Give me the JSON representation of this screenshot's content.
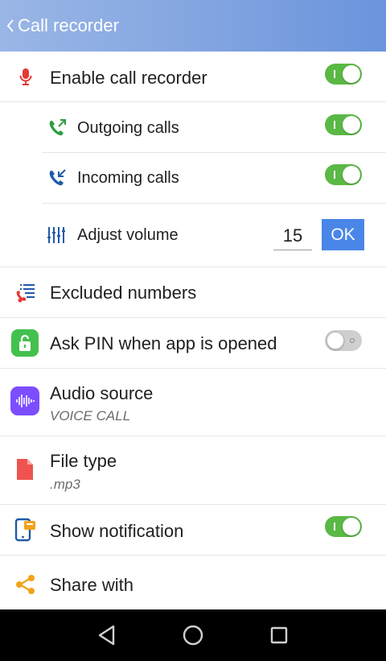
{
  "header": {
    "title": "Call recorder"
  },
  "rows": {
    "enable": {
      "label": "Enable call recorder",
      "icon": "microphone-icon",
      "toggle": true
    },
    "outgoing": {
      "label": "Outgoing calls",
      "icon": "outgoing-call-icon",
      "toggle": true
    },
    "incoming": {
      "label": "Incoming calls",
      "icon": "incoming-call-icon",
      "toggle": true
    },
    "volume": {
      "label": "Adjust volume",
      "icon": "volume-bars-icon",
      "value": "15",
      "ok_label": "OK"
    },
    "excluded": {
      "label": "Excluded numbers",
      "icon": "excluded-list-icon"
    },
    "pin": {
      "label": "Ask PIN when app is opened",
      "icon": "lock-icon",
      "toggle": false
    },
    "audio": {
      "label": "Audio source",
      "value": "VOICE CALL",
      "icon": "audio-wave-icon"
    },
    "filetype": {
      "label": "File type",
      "value": ".mp3",
      "icon": "file-icon"
    },
    "notification": {
      "label": "Show notification",
      "icon": "notification-phone-icon",
      "toggle": true
    },
    "share": {
      "label": "Share with",
      "icon": "share-icon"
    }
  },
  "colors": {
    "header": "#7fa2e0",
    "toggle_on": "#5ab845",
    "ok_button": "#4a86e8",
    "mic": "#e53935",
    "call_green": "#2e9e3f",
    "call_blue": "#1e5aa8",
    "lock_bg": "#43c14e",
    "audio_bg": "#7c4dff",
    "file": "#ef5350",
    "share": "#f2a31a"
  },
  "navbar": {
    "back": "back-triangle-icon",
    "home": "home-circle-icon",
    "recents": "recents-square-icon"
  }
}
